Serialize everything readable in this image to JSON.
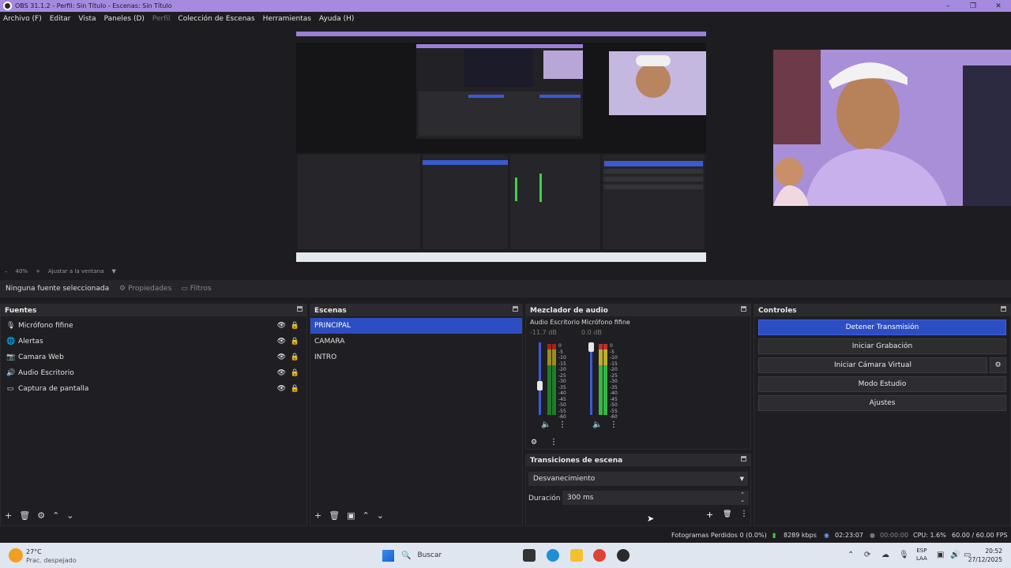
{
  "window": {
    "title": "OBS 31.1.2 - Perfil: Sin Título - Escenas: Sin Título",
    "controls": [
      "–",
      "❐",
      "✕"
    ]
  },
  "menu": [
    {
      "label": "Archivo (F)"
    },
    {
      "label": "Editar"
    },
    {
      "label": "Vista"
    },
    {
      "label": "Paneles (D)"
    },
    {
      "label": "Perfil"
    },
    {
      "label": "Colección de Escenas"
    },
    {
      "label": "Herramientas"
    },
    {
      "label": "Ayuda (H)"
    }
  ],
  "zoom": {
    "minus": "–",
    "value": "40%",
    "plus": "+",
    "fit": "Ajustar a la ventana"
  },
  "properties_bar": {
    "no_source": "Ninguna fuente seleccionada",
    "properties": "Propiedades",
    "filters": "Filtros"
  },
  "sources": {
    "title": "Fuentes",
    "items": [
      {
        "label": "Micrófono fifine",
        "icon": "microphone-icon"
      },
      {
        "label": "Alertas",
        "icon": "globe-icon"
      },
      {
        "label": "Camara Web",
        "icon": "camera-icon"
      },
      {
        "label": "Audio Escritorio",
        "icon": "speaker-icon"
      },
      {
        "label": "Captura de pantalla",
        "icon": "monitor-icon"
      }
    ]
  },
  "scenes": {
    "title": "Escenas",
    "items": [
      {
        "label": "PRINCIPAL",
        "selected": true
      },
      {
        "label": "CAMARA",
        "selected": false
      },
      {
        "label": "INTRO",
        "selected": false
      }
    ]
  },
  "mixer": {
    "title": "Mezclador de audio",
    "channels": [
      {
        "name": "Audio Escritorio",
        "db": "-11.7 dB"
      },
      {
        "name": "Micrófono fifine",
        "db": "0.0 dB"
      }
    ],
    "scale": [
      "0",
      "-5",
      "-10",
      "-15",
      "-20",
      "-25",
      "-30",
      "-35",
      "-40",
      "-45",
      "-50",
      "-55",
      "-60"
    ]
  },
  "transitions": {
    "title": "Transiciones de escena",
    "selected": "Desvanecimiento",
    "duration_label": "Duración",
    "duration_value": "300 ms"
  },
  "controls": {
    "title": "Controles",
    "buttons": [
      {
        "label": "Detener Transmisión",
        "active": true
      },
      {
        "label": "Iniciar Grabación",
        "active": false
      },
      {
        "label": "Iniciar Cámara Virtual",
        "active": false
      },
      {
        "label": "Modo Estudio",
        "active": false
      },
      {
        "label": "Ajustes",
        "active": false
      }
    ]
  },
  "status": {
    "dropped": "Fotogramas Perdidos 0 (0.0%)",
    "bitrate": "8289 kbps",
    "stream_time": "02:23:07",
    "rec_time": "00:00:00",
    "cpu": "CPU: 1.6%",
    "fps": "60.00 / 60.00 FPS"
  },
  "taskbar": {
    "temp": "27°C",
    "condition": "Prac. despejado",
    "search": "Buscar",
    "lang1": "ESP",
    "lang2": "LAA",
    "time": "20:52",
    "date": "27/12/2025"
  },
  "colors": {
    "accent": "#2d4ec2",
    "titlebar": "#a58ae0",
    "panel": "#1f1f23"
  }
}
